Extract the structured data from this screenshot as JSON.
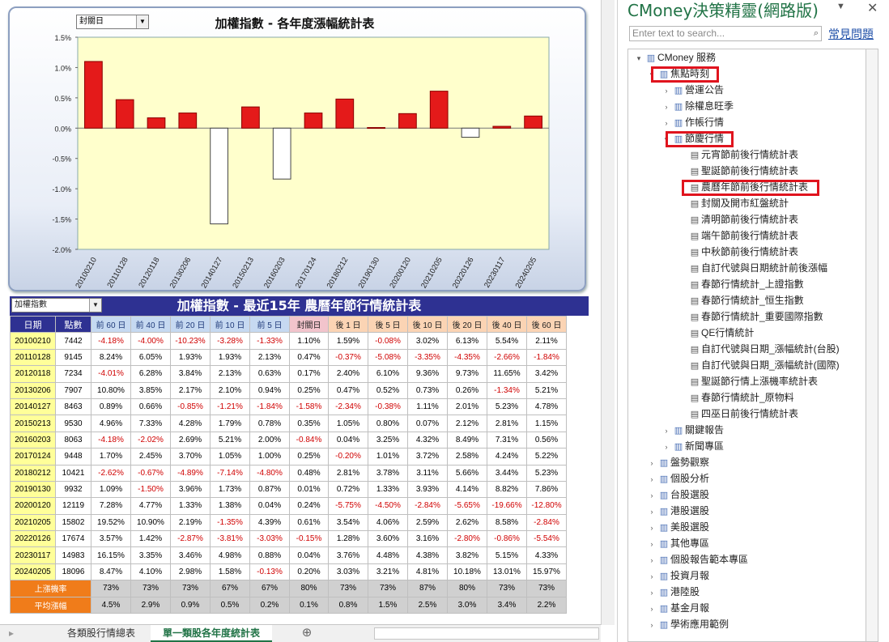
{
  "chart": {
    "selector_value": "封關日",
    "title": "加權指數 - 各年度漲幅統計表",
    "colors": {
      "positive": "#e41a1a",
      "negative": "#ffffff",
      "plot_bg": "#ffffcc",
      "title_bar": "#2e3192"
    }
  },
  "chart_data": {
    "type": "bar",
    "title": "加權指數 - 各年度漲幅統計表",
    "categories": [
      "20100210",
      "20110128",
      "20120118",
      "20130206",
      "20140127",
      "20150213",
      "20160203",
      "20170124",
      "20180212",
      "20190130",
      "20200120",
      "20210205",
      "20220126",
      "20230117",
      "20240205"
    ],
    "values": [
      1.1,
      0.47,
      0.17,
      0.25,
      -1.58,
      0.35,
      -0.84,
      0.25,
      0.48,
      0.01,
      0.24,
      0.61,
      -0.15,
      0.03,
      0.2
    ],
    "ylim": [
      -2.0,
      1.5
    ],
    "yticks": [
      "1.5%",
      "1.0%",
      "0.5%",
      "0.0%",
      "-0.5%",
      "-1.0%",
      "-1.5%",
      "-2.0%"
    ],
    "grid": false
  },
  "table": {
    "selector_value": "加權指數",
    "title": "加權指數 - 最近15年 農曆年節行情統計表",
    "headers": [
      "日期",
      "點數",
      "前 60 日",
      "前 40 日",
      "前 20 日",
      "前 10 日",
      "前 5 日",
      "封關日",
      "後 1 日",
      "後 5 日",
      "後 10 日",
      "後 20 日",
      "後 40 日",
      "後 60 日"
    ],
    "rows": [
      [
        "20100210",
        "7442",
        "-4.18%",
        "-4.00%",
        "-10.23%",
        "-3.28%",
        "-1.33%",
        "1.10%",
        "1.59%",
        "-0.08%",
        "3.02%",
        "6.13%",
        "5.54%",
        "2.11%"
      ],
      [
        "20110128",
        "9145",
        "8.24%",
        "6.05%",
        "1.93%",
        "1.93%",
        "2.13%",
        "0.47%",
        "-0.37%",
        "-5.08%",
        "-3.35%",
        "-4.35%",
        "-2.66%",
        "-1.84%"
      ],
      [
        "20120118",
        "7234",
        "-4.01%",
        "6.28%",
        "3.84%",
        "2.13%",
        "0.63%",
        "0.17%",
        "2.40%",
        "6.10%",
        "9.36%",
        "9.73%",
        "11.65%",
        "3.42%"
      ],
      [
        "20130206",
        "7907",
        "10.80%",
        "3.85%",
        "2.17%",
        "2.10%",
        "0.94%",
        "0.25%",
        "0.47%",
        "0.52%",
        "0.73%",
        "0.26%",
        "-1.34%",
        "5.21%"
      ],
      [
        "20140127",
        "8463",
        "0.89%",
        "0.66%",
        "-0.85%",
        "-1.21%",
        "-1.84%",
        "-1.58%",
        "-2.34%",
        "-0.38%",
        "1.11%",
        "2.01%",
        "5.23%",
        "4.78%"
      ],
      [
        "20150213",
        "9530",
        "4.96%",
        "7.33%",
        "4.28%",
        "1.79%",
        "0.78%",
        "0.35%",
        "1.05%",
        "0.80%",
        "0.07%",
        "2.12%",
        "2.81%",
        "1.15%"
      ],
      [
        "20160203",
        "8063",
        "-4.18%",
        "-2.02%",
        "2.69%",
        "5.21%",
        "2.00%",
        "-0.84%",
        "0.04%",
        "3.25%",
        "4.32%",
        "8.49%",
        "7.31%",
        "0.56%"
      ],
      [
        "20170124",
        "9448",
        "1.70%",
        "2.45%",
        "3.70%",
        "1.05%",
        "1.00%",
        "0.25%",
        "-0.20%",
        "1.01%",
        "3.72%",
        "2.58%",
        "4.24%",
        "5.22%"
      ],
      [
        "20180212",
        "10421",
        "-2.62%",
        "-0.67%",
        "-4.89%",
        "-7.14%",
        "-4.80%",
        "0.48%",
        "2.81%",
        "3.78%",
        "3.11%",
        "5.66%",
        "3.44%",
        "5.23%"
      ],
      [
        "20190130",
        "9932",
        "1.09%",
        "-1.50%",
        "3.96%",
        "1.73%",
        "0.87%",
        "0.01%",
        "0.72%",
        "1.33%",
        "3.93%",
        "4.14%",
        "8.82%",
        "7.86%"
      ],
      [
        "20200120",
        "12119",
        "7.28%",
        "4.77%",
        "1.33%",
        "1.38%",
        "0.04%",
        "0.24%",
        "-5.75%",
        "-4.50%",
        "-2.84%",
        "-5.65%",
        "-19.66%",
        "-12.80%"
      ],
      [
        "20210205",
        "15802",
        "19.52%",
        "10.90%",
        "2.19%",
        "-1.35%",
        "4.39%",
        "0.61%",
        "3.54%",
        "4.06%",
        "2.59%",
        "2.62%",
        "8.58%",
        "-2.84%"
      ],
      [
        "20220126",
        "17674",
        "3.57%",
        "1.42%",
        "-2.87%",
        "-3.81%",
        "-3.03%",
        "-0.15%",
        "1.28%",
        "3.60%",
        "3.16%",
        "-2.80%",
        "-0.86%",
        "-5.54%"
      ],
      [
        "20230117",
        "14983",
        "16.15%",
        "3.35%",
        "3.46%",
        "4.98%",
        "0.88%",
        "0.04%",
        "3.76%",
        "4.48%",
        "4.38%",
        "3.82%",
        "5.15%",
        "4.33%"
      ],
      [
        "20240205",
        "18096",
        "8.47%",
        "4.10%",
        "2.98%",
        "1.58%",
        "-0.13%",
        "0.20%",
        "3.03%",
        "3.21%",
        "4.81%",
        "10.18%",
        "13.01%",
        "15.97%"
      ]
    ],
    "summary": [
      {
        "label": "上漲機率",
        "values": [
          "73%",
          "73%",
          "73%",
          "67%",
          "67%",
          "80%",
          "73%",
          "73%",
          "87%",
          "80%",
          "73%",
          "73%"
        ]
      },
      {
        "label": "平均漲幅",
        "values": [
          "4.5%",
          "2.9%",
          "0.9%",
          "0.5%",
          "0.2%",
          "0.1%",
          "0.8%",
          "1.5%",
          "2.5%",
          "3.0%",
          "3.4%",
          "2.2%"
        ]
      }
    ]
  },
  "sheet_tabs": {
    "tabs": [
      "各類股行情總表",
      "單一類股各年度統計表"
    ],
    "active": "單一類股各年度統計表",
    "add_icon": "plus-circle-icon"
  },
  "panel": {
    "title": "CMoney決策精靈(網路版)",
    "search_placeholder": "Enter text to search...",
    "faq_link": "常見問題",
    "tree": [
      {
        "label": "CMoney 服務",
        "level": 0,
        "expanded": true,
        "leaf": false
      },
      {
        "label": "焦點時刻",
        "level": 1,
        "expanded": true,
        "leaf": false,
        "highlight": true
      },
      {
        "label": "營運公告",
        "level": 2,
        "expanded": false,
        "leaf": false
      },
      {
        "label": "除權息旺季",
        "level": 2,
        "expanded": false,
        "leaf": false
      },
      {
        "label": "作帳行情",
        "level": 2,
        "expanded": false,
        "leaf": false
      },
      {
        "label": "節慶行情",
        "level": 2,
        "expanded": true,
        "leaf": false,
        "highlight": true
      },
      {
        "label": "元宵節前後行情統計表",
        "level": 3,
        "leaf": true
      },
      {
        "label": "聖誕節前後行情統計表",
        "level": 3,
        "leaf": true
      },
      {
        "label": "農曆年節前後行情統計表",
        "level": 3,
        "leaf": true,
        "highlight": true
      },
      {
        "label": "封關及開市紅盤統計",
        "level": 3,
        "leaf": true
      },
      {
        "label": "清明節前後行情統計表",
        "level": 3,
        "leaf": true
      },
      {
        "label": "端午節前後行情統計表",
        "level": 3,
        "leaf": true
      },
      {
        "label": "中秋節前後行情統計表",
        "level": 3,
        "leaf": true
      },
      {
        "label": "自訂代號與日期統計前後漲幅",
        "level": 3,
        "leaf": true
      },
      {
        "label": "春節行情統計_上證指數",
        "level": 3,
        "leaf": true
      },
      {
        "label": "春節行情統計_恒生指數",
        "level": 3,
        "leaf": true
      },
      {
        "label": "春節行情統計_重要國際指數",
        "level": 3,
        "leaf": true
      },
      {
        "label": "QE行情統計",
        "level": 3,
        "leaf": true
      },
      {
        "label": "自訂代號與日期_漲幅統計(台股)",
        "level": 3,
        "leaf": true
      },
      {
        "label": "自訂代號與日期_漲幅統計(國際)",
        "level": 3,
        "leaf": true
      },
      {
        "label": "聖誕節行情上漲機率統計表",
        "level": 3,
        "leaf": true
      },
      {
        "label": "春節行情統計_原物料",
        "level": 3,
        "leaf": true
      },
      {
        "label": "四巫日前後行情統計表",
        "level": 3,
        "leaf": true
      },
      {
        "label": "關鍵報告",
        "level": 2,
        "expanded": false,
        "leaf": false
      },
      {
        "label": "新聞專區",
        "level": 2,
        "expanded": false,
        "leaf": false
      },
      {
        "label": "盤勢觀察",
        "level": 1,
        "expanded": false,
        "leaf": false
      },
      {
        "label": "個股分析",
        "level": 1,
        "expanded": false,
        "leaf": false
      },
      {
        "label": "台股選股",
        "level": 1,
        "expanded": false,
        "leaf": false
      },
      {
        "label": "港股選股",
        "level": 1,
        "expanded": false,
        "leaf": false
      },
      {
        "label": "美股選股",
        "level": 1,
        "expanded": false,
        "leaf": false
      },
      {
        "label": "其他專區",
        "level": 1,
        "expanded": false,
        "leaf": false
      },
      {
        "label": "個股報告範本專區",
        "level": 1,
        "expanded": false,
        "leaf": false
      },
      {
        "label": "投資月報",
        "level": 1,
        "expanded": false,
        "leaf": false
      },
      {
        "label": "港陸股",
        "level": 1,
        "expanded": false,
        "leaf": false
      },
      {
        "label": "基金月報",
        "level": 1,
        "expanded": false,
        "leaf": false
      },
      {
        "label": "學術應用範例",
        "level": 1,
        "expanded": false,
        "leaf": false
      }
    ]
  }
}
